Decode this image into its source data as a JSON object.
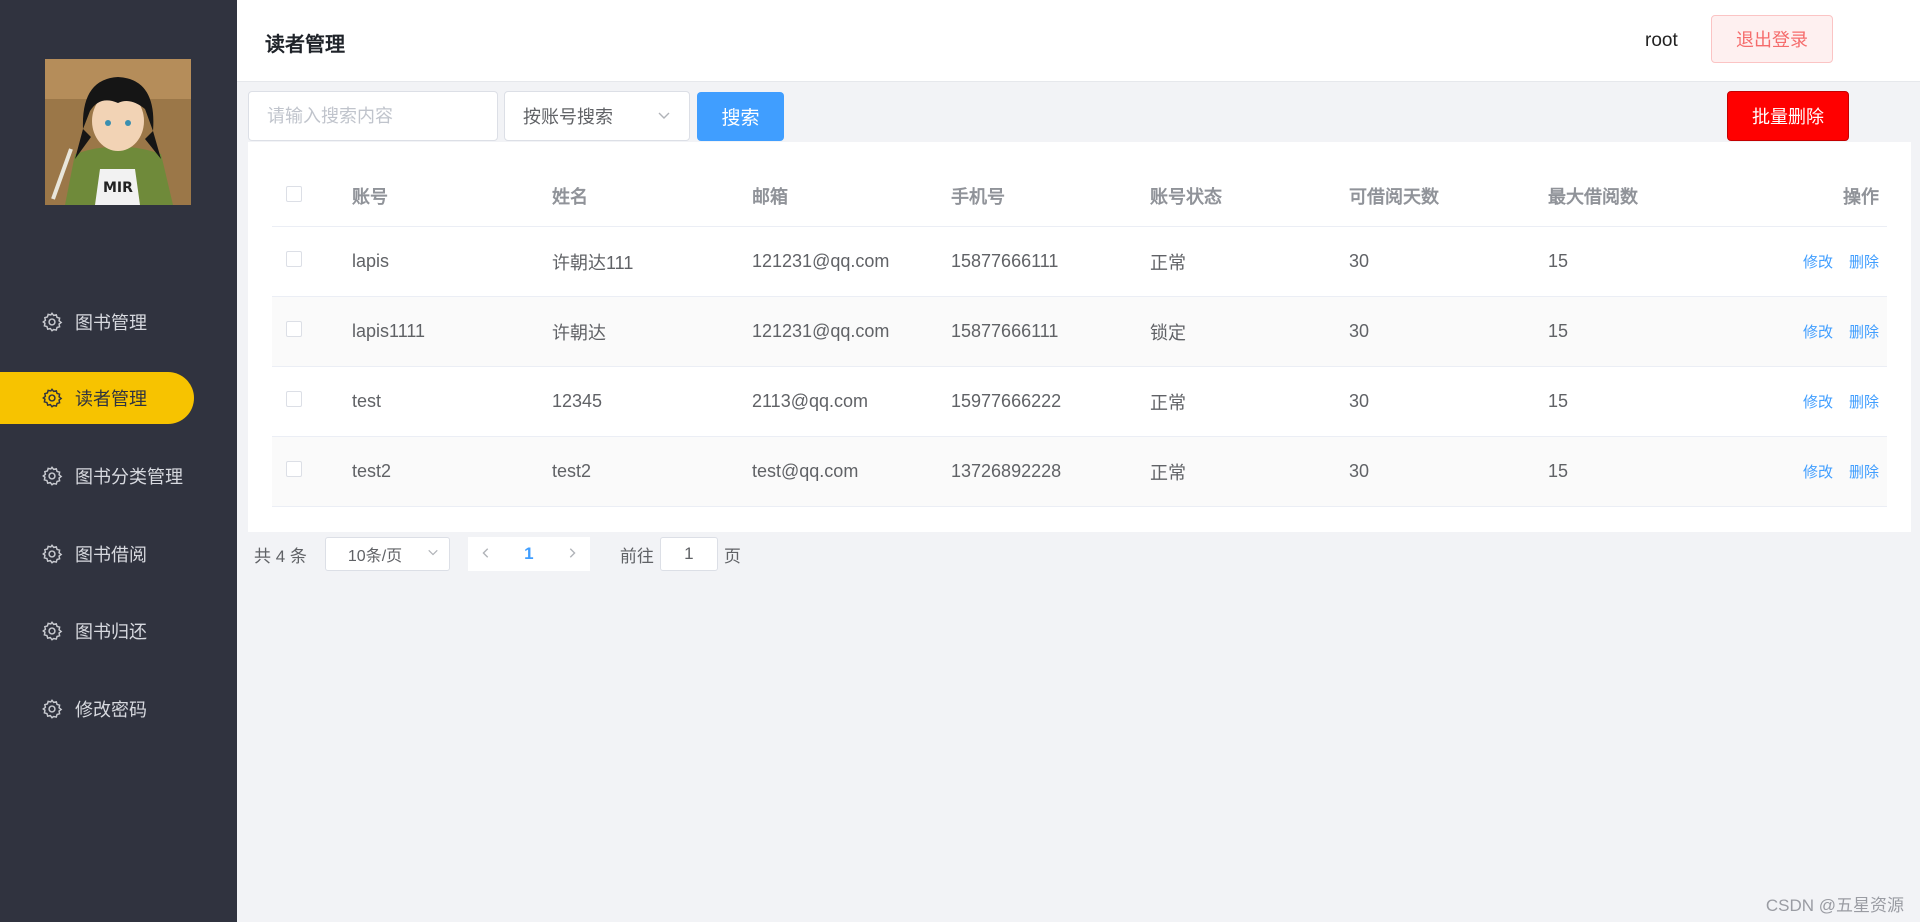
{
  "sidebar": {
    "items": [
      {
        "label": "图书管理",
        "active": false
      },
      {
        "label": "读者管理",
        "active": true
      },
      {
        "label": "图书分类管理",
        "active": false
      },
      {
        "label": "图书借阅",
        "active": false
      },
      {
        "label": "图书归还",
        "active": false
      },
      {
        "label": "修改密码",
        "active": false
      }
    ],
    "item_icon": "gear-icon",
    "active_color": "#f7c300",
    "background": "#30333f"
  },
  "header": {
    "title": "读者管理",
    "username": "root",
    "logout_label": "退出登录"
  },
  "toolbar": {
    "search_placeholder": "请输入搜索内容",
    "search_value": "",
    "search_by": "按账号搜索",
    "search_label": "搜索",
    "batch_delete_label": "批量删除"
  },
  "table": {
    "columns": [
      "账号",
      "姓名",
      "邮箱",
      "手机号",
      "账号状态",
      "可借阅天数",
      "最大借阅数",
      "操作"
    ],
    "rows": [
      {
        "account": "lapis",
        "name": "许朝达111",
        "email": "121231@qq.com",
        "phone": "15877666111",
        "status": "正常",
        "days": "30",
        "max": "15"
      },
      {
        "account": "lapis1111",
        "name": "许朝达",
        "email": "121231@qq.com",
        "phone": "15877666111",
        "status": "锁定",
        "days": "30",
        "max": "15"
      },
      {
        "account": "test",
        "name": "12345",
        "email": "2113@qq.com",
        "phone": "15977666222",
        "status": "正常",
        "days": "30",
        "max": "15"
      },
      {
        "account": "test2",
        "name": "test2",
        "email": "test@qq.com",
        "phone": "13726892228",
        "status": "正常",
        "days": "30",
        "max": "15"
      }
    ],
    "edit_label": "修改",
    "delete_label": "删除"
  },
  "pagination": {
    "total_text": "共 4 条",
    "page_size": "10条/页",
    "current_page": "1",
    "goto_prefix": "前往",
    "goto_value": "1",
    "goto_suffix": "页"
  },
  "watermark": "CSDN @五星资源"
}
